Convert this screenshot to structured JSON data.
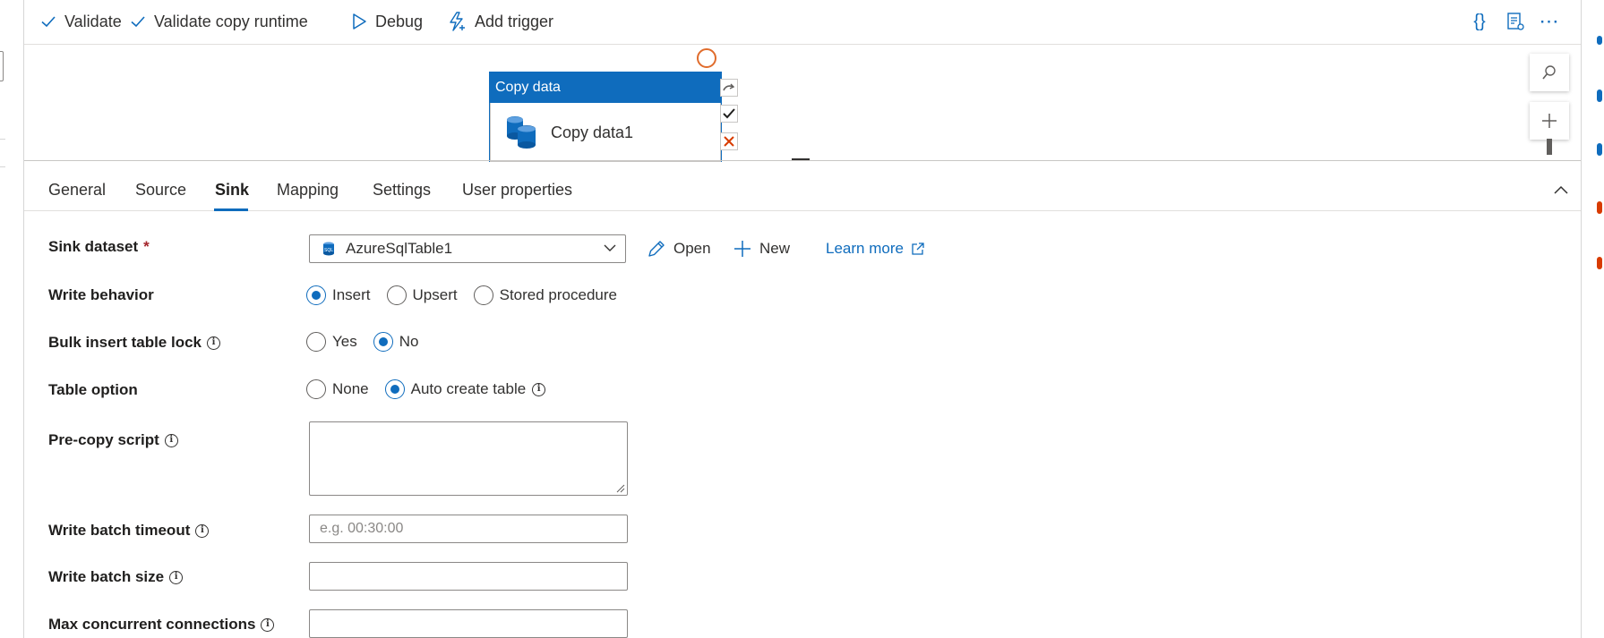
{
  "toolbar": {
    "validate": "Validate",
    "validate_copy_runtime": "Validate copy runtime",
    "debug": "Debug",
    "add_trigger": "Add trigger"
  },
  "canvas": {
    "activity_type": "Copy data",
    "activity_name": "Copy data1",
    "status_color": "#e06c2c",
    "header_color": "#0f6cbd"
  },
  "tabs": [
    {
      "label": "General",
      "active": false
    },
    {
      "label": "Source",
      "active": false
    },
    {
      "label": "Sink",
      "active": true
    },
    {
      "label": "Mapping",
      "active": false
    },
    {
      "label": "Settings",
      "active": false
    },
    {
      "label": "User properties",
      "active": false
    }
  ],
  "sink": {
    "dataset_label": "Sink dataset",
    "required_mark": "*",
    "dataset_value": "AzureSqlTable1",
    "open": "Open",
    "new": "New",
    "learn_more": "Learn more",
    "write_behavior_label": "Write behavior",
    "write_behavior_options": [
      "Insert",
      "Upsert",
      "Stored procedure"
    ],
    "write_behavior_selected": "Insert",
    "bulk_lock_label": "Bulk insert table lock",
    "bulk_lock_options": [
      "Yes",
      "No"
    ],
    "bulk_lock_selected": "No",
    "table_option_label": "Table option",
    "table_option_options": [
      "None",
      "Auto create table"
    ],
    "table_option_selected": "Auto create table",
    "pre_copy_label": "Pre-copy script",
    "pre_copy_value": "",
    "batch_timeout_label": "Write batch timeout",
    "batch_timeout_placeholder": "e.g. 00:30:00",
    "batch_size_label": "Write batch size",
    "batch_size_value": "",
    "max_conn_label": "Max concurrent connections",
    "max_conn_value": ""
  },
  "icons": {
    "toolbar_right": [
      "code-braces-icon",
      "properties-icon",
      "more-icon"
    ],
    "canvas_tools": [
      "search-icon",
      "zoom-in-icon"
    ]
  },
  "accent_color": "#0f6cbd"
}
